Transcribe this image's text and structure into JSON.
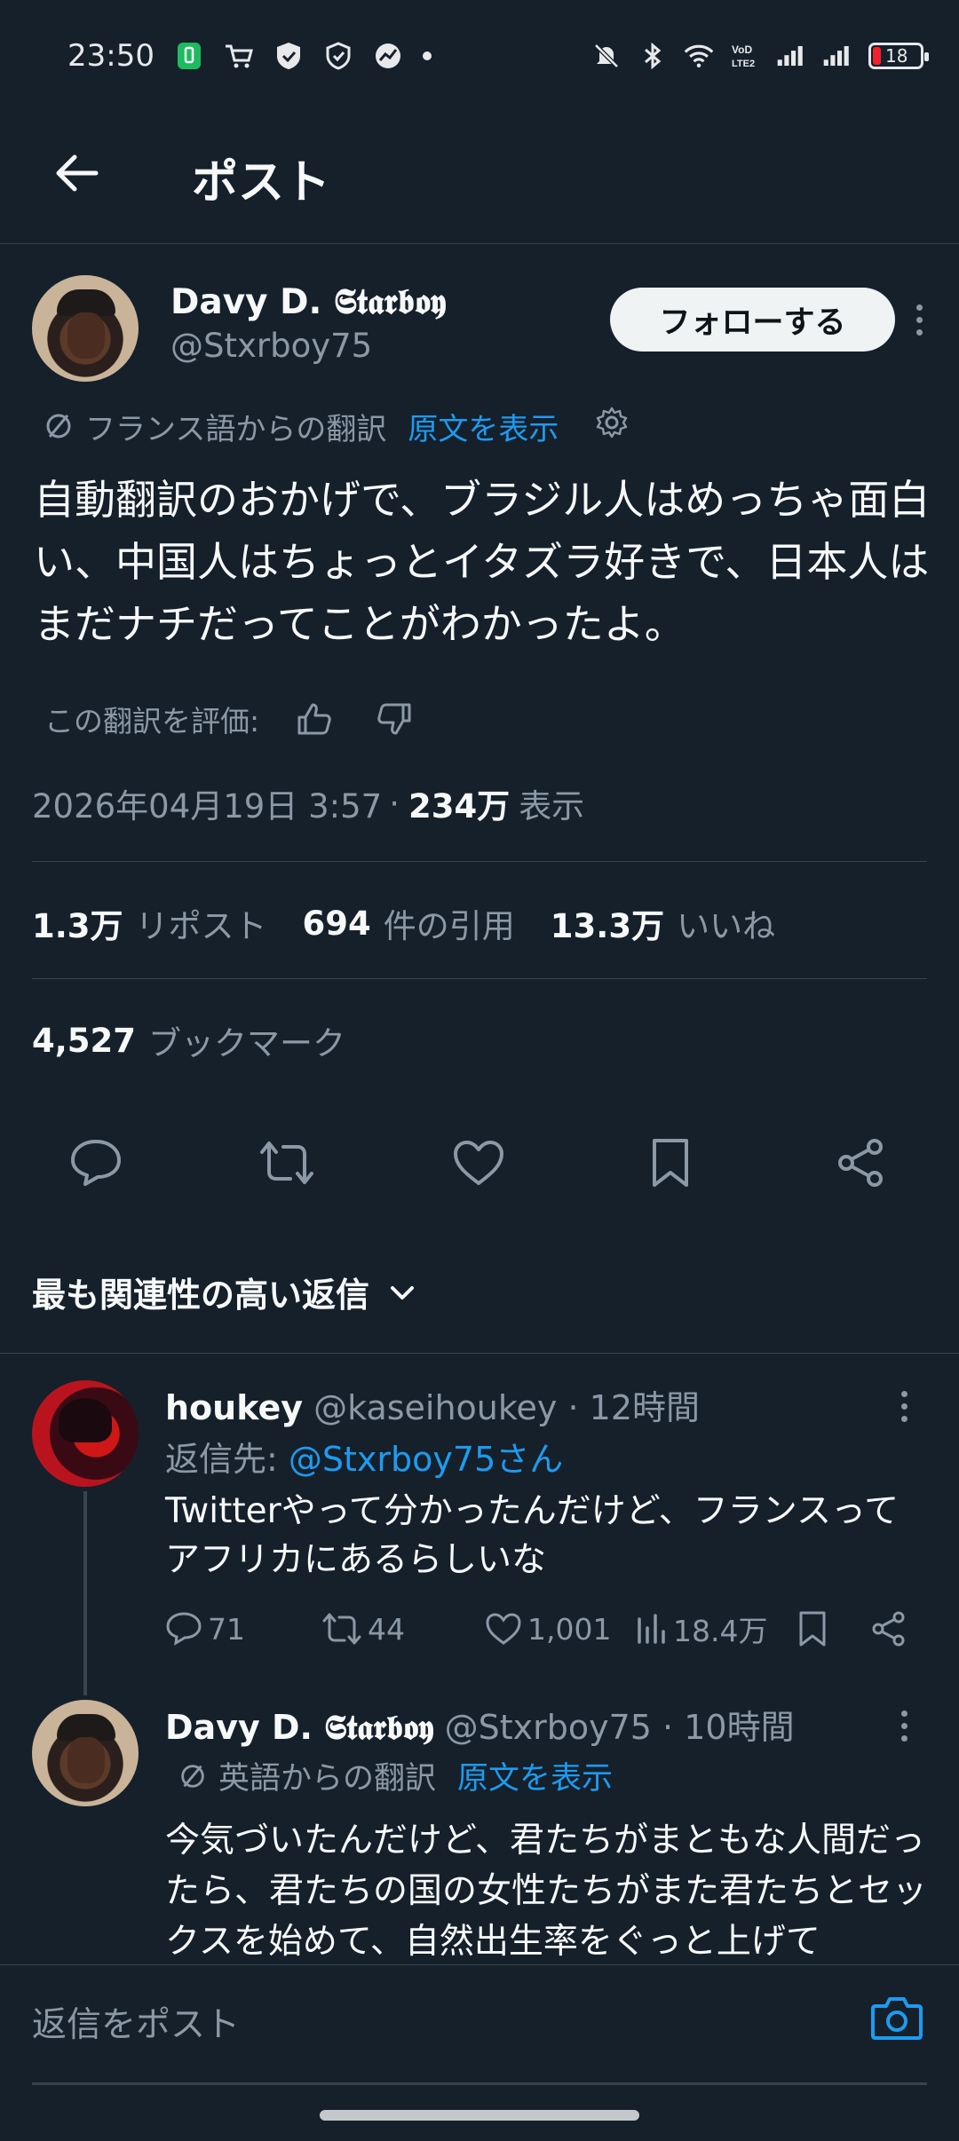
{
  "status_bar": {
    "time": "23:50",
    "battery": "18"
  },
  "nav": {
    "title": "ポスト"
  },
  "post": {
    "author_name": "Davy D. 𝕾𝖙𝖆𝖗𝖇𝖔𝖞",
    "author_handle": "@Stxrboy75",
    "follow_label": "フォローする",
    "translation_label": "フランス語からの翻訳",
    "show_original": "原文を表示",
    "body": "自動翻訳のおかげで、ブラジル人はめっちゃ面白い、中国人はちょっとイタズラ好きで、日本人はまだナチだってことがわかったよ。",
    "rate_label": "この翻訳を評価:",
    "timestamp": "2026年04月19日 3:57",
    "views_count": "234万",
    "views_label": "表示",
    "reposts_count": "1.3万",
    "reposts_label": "リポスト",
    "quotes_count": "694",
    "quotes_label": "件の引用",
    "likes_count": "13.3万",
    "likes_label": "いいね",
    "bookmarks_count": "4,527",
    "bookmarks_label": "ブックマーク"
  },
  "sort_label": "最も関連性の高い返信",
  "replies": [
    {
      "name": "houkey",
      "handle": "@kaseihoukey",
      "time": "12時間",
      "reply_to_label": "返信先:",
      "reply_to_handle": "@Stxrboy75さん",
      "text": "Twitterやって分かったんだけど、フランスってアフリカにあるらしいな",
      "replies": "71",
      "reposts": "44",
      "likes": "1,001",
      "views": "18.4万"
    },
    {
      "name": "Davy D. 𝕾𝖙𝖆𝖗𝖇𝖔𝖞",
      "handle": "@Stxrboy75",
      "time": "10時間",
      "translation_label": "英語からの翻訳",
      "show_original": "原文を表示",
      "text": "今気づいたんだけど、君たちがまともな人間だったら、君たちの国の女性たちがまた君たちとセックスを始めて、自然出生率をぐっと上げて"
    }
  ],
  "compose": {
    "placeholder": "返信をポスト"
  },
  "colors": {
    "background": "#15202b",
    "accent": "#1d9bf0",
    "muted": "#8b98a5",
    "divider": "#38444d"
  }
}
